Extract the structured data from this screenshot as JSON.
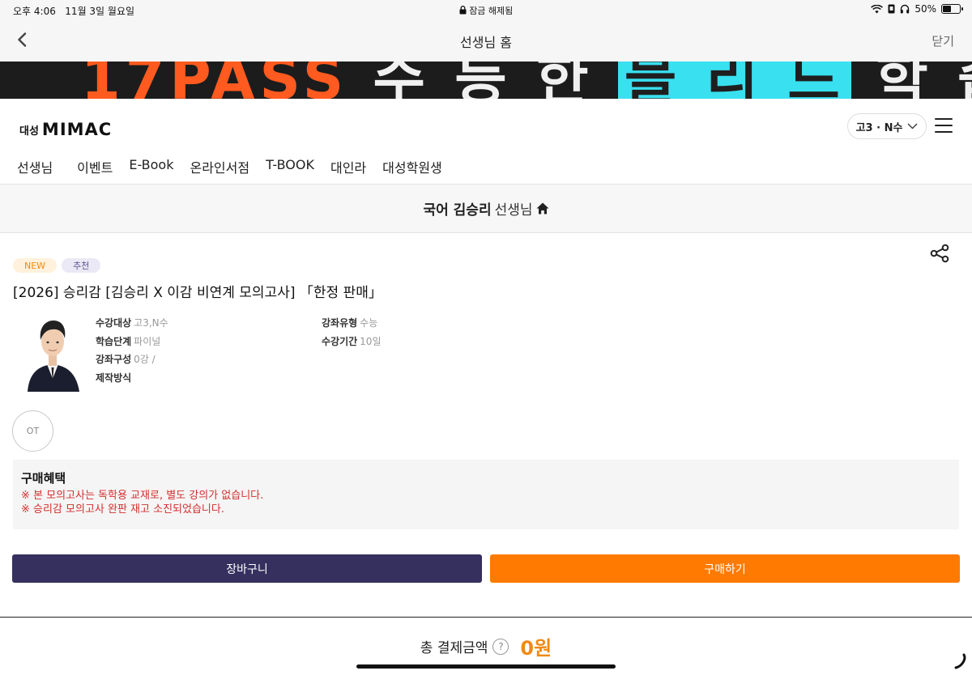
{
  "status_bar": {
    "time": "오후 4:06",
    "date": "11월 3일 월요일",
    "lock_text": "잠금 해제됨",
    "battery": "50%",
    "battery_level": 0.5
  },
  "browser": {
    "title": "선생님 홈",
    "close_label": "닫기"
  },
  "banner": {
    "text_orange": "17PASS",
    "text_prefix": "수 등 한",
    "text_cyan": "블 리 드",
    "text_suffix": "학 습 전 략"
  },
  "header": {
    "logo_sub": "대성",
    "logo_main": "MIMAC",
    "grade_select": "고3 · N수",
    "nav": [
      "선생님",
      "이벤트",
      "E-Book",
      "온라인서점",
      "T-BOOK",
      "대인라",
      "대성학원생"
    ]
  },
  "teacher": {
    "name": "국어 김승리",
    "suffix": "선생님"
  },
  "product": {
    "badges": [
      "NEW",
      "추천"
    ],
    "title": "[2026] 승리감 [김승리 X 이감 비연계 모의고사] 「한정 판매」",
    "info_left": [
      {
        "label": "수강대상",
        "value": "고3,N수"
      },
      {
        "label": "학습단계",
        "value": "파이널"
      },
      {
        "label": "강좌구성",
        "value": "0강 /"
      },
      {
        "label": "제작방식",
        "value": ""
      }
    ],
    "info_right": [
      {
        "label": "강좌유형",
        "value": "수능"
      },
      {
        "label": "수강기간",
        "value": "10일"
      }
    ],
    "ot_label": "OT"
  },
  "benefit": {
    "title": "구매혜택",
    "lines": [
      "※ 본 모의고사는 독학용 교재로, 별도 강의가 없습니다.",
      "※ 승리감 모의고사 완판 재고 소진되었습니다."
    ]
  },
  "buttons": {
    "cart": "장바구니",
    "buy": "구매하기"
  },
  "total": {
    "label": "총 결제금액",
    "help": "?",
    "amount": "0원"
  },
  "colors": {
    "cart_button": "#35305e",
    "buy_button": "#ff7a00",
    "amount": "#f08a14",
    "notice_red": "#d32f2f"
  }
}
